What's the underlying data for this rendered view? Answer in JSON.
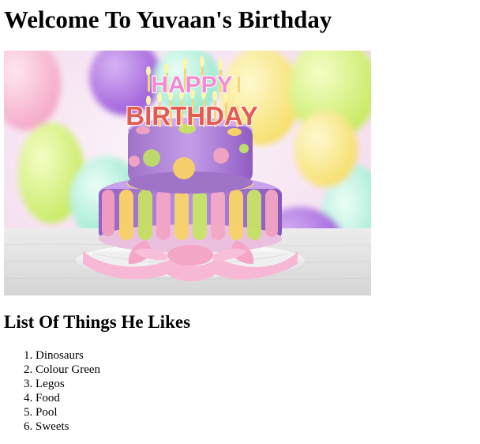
{
  "page": {
    "title": "Welcome To Yuvaan's Birthday"
  },
  "hero_image": {
    "cake_topper_line1": "HAPPY",
    "cake_topper_line2": "BIRTHDAY"
  },
  "likes_section": {
    "heading": "List Of Things He Likes",
    "items": [
      "Dinosaurs",
      "Colour Green",
      "Legos",
      "Food",
      "Pool",
      "Sweets"
    ]
  }
}
